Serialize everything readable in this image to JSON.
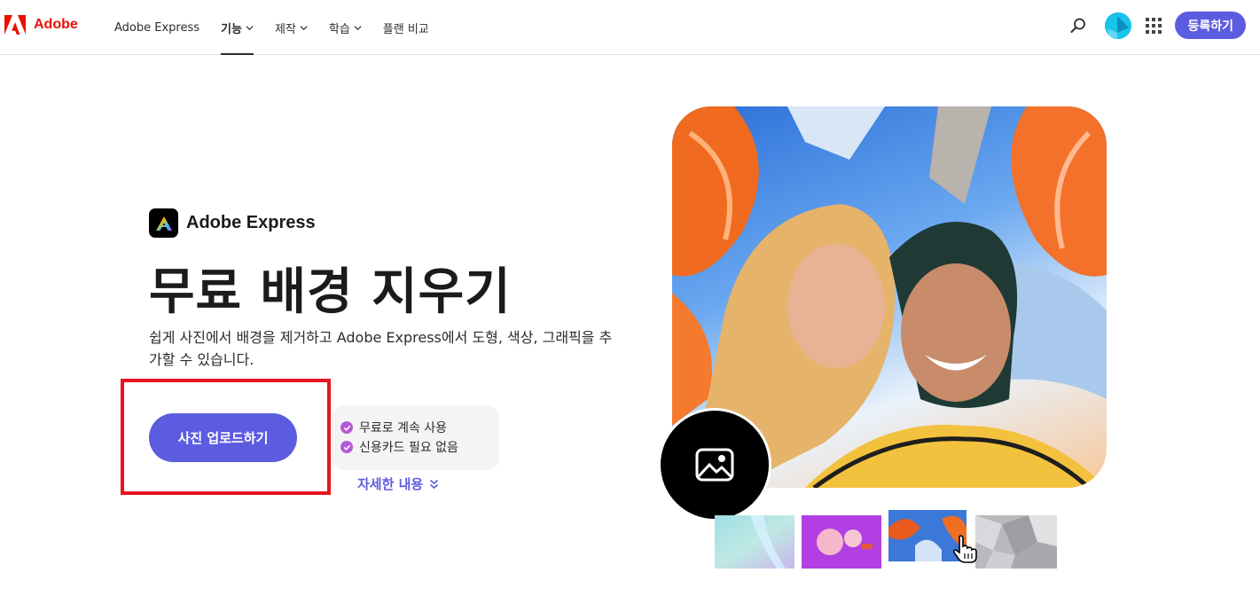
{
  "nav": {
    "brand": "Adobe",
    "items": [
      {
        "label": "Adobe Express",
        "dropdown": false,
        "active": false
      },
      {
        "label": "기능",
        "dropdown": true,
        "active": true
      },
      {
        "label": "제작",
        "dropdown": true,
        "active": false
      },
      {
        "label": "학습",
        "dropdown": true,
        "active": false
      },
      {
        "label": "플랜 비교",
        "dropdown": false,
        "active": false
      }
    ],
    "signup_label": "등록하기"
  },
  "hero": {
    "product_name": "Adobe Express",
    "title": "무료 배경 지우기",
    "description": "쉽게 사진에서 배경을 제거하고 Adobe Express에서 도형, 색상, 그래픽을 추가할 수 있습니다.",
    "upload_label": "사진 업로드하기",
    "perks": [
      "무료로 계속 사용",
      "신용카드 필요 없음"
    ],
    "more_label": "자세한 내용"
  },
  "colors": {
    "accent": "#5c5ce0",
    "adobe_red": "#eb1000",
    "highlight": "#e8141e",
    "perk_check": "#b45ad6"
  },
  "icons": [
    "adobe-logo-icon",
    "chevron-down-icon",
    "search-icon",
    "apps-grid-icon",
    "image-icon",
    "check-icon",
    "double-chevron-down-icon",
    "hand-cursor-icon"
  ]
}
